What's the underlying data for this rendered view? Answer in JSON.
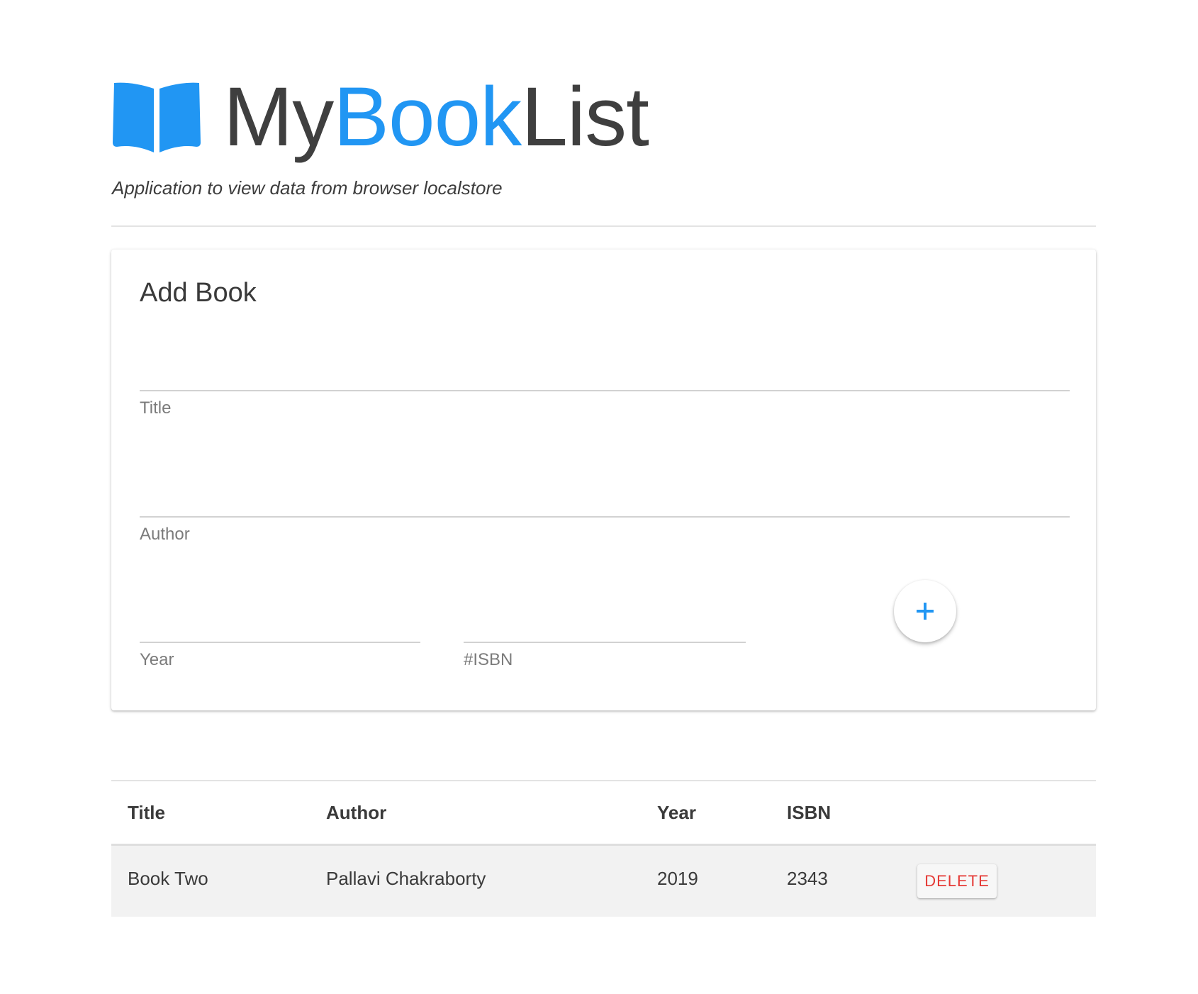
{
  "header": {
    "logo_icon": "open-book-icon",
    "brand_part1": "My",
    "brand_part2": "Book",
    "brand_part3": "List",
    "tagline": "Application to view data from browser localstore",
    "accent_color": "#2196f3"
  },
  "add_book": {
    "title": "Add Book",
    "fields": {
      "title": {
        "label": "Title",
        "value": ""
      },
      "author": {
        "label": "Author",
        "value": ""
      },
      "year": {
        "label": "Year",
        "value": ""
      },
      "isbn": {
        "label": "#ISBN",
        "value": ""
      }
    },
    "add_button_icon": "plus-icon"
  },
  "books_table": {
    "columns": [
      "Title",
      "Author",
      "Year",
      "ISBN"
    ],
    "rows": [
      {
        "title": "Book Two",
        "author": "Pallavi Chakraborty",
        "year": "2019",
        "isbn": "2343",
        "action_label": "DELETE"
      }
    ],
    "delete_color": "#e53935"
  }
}
